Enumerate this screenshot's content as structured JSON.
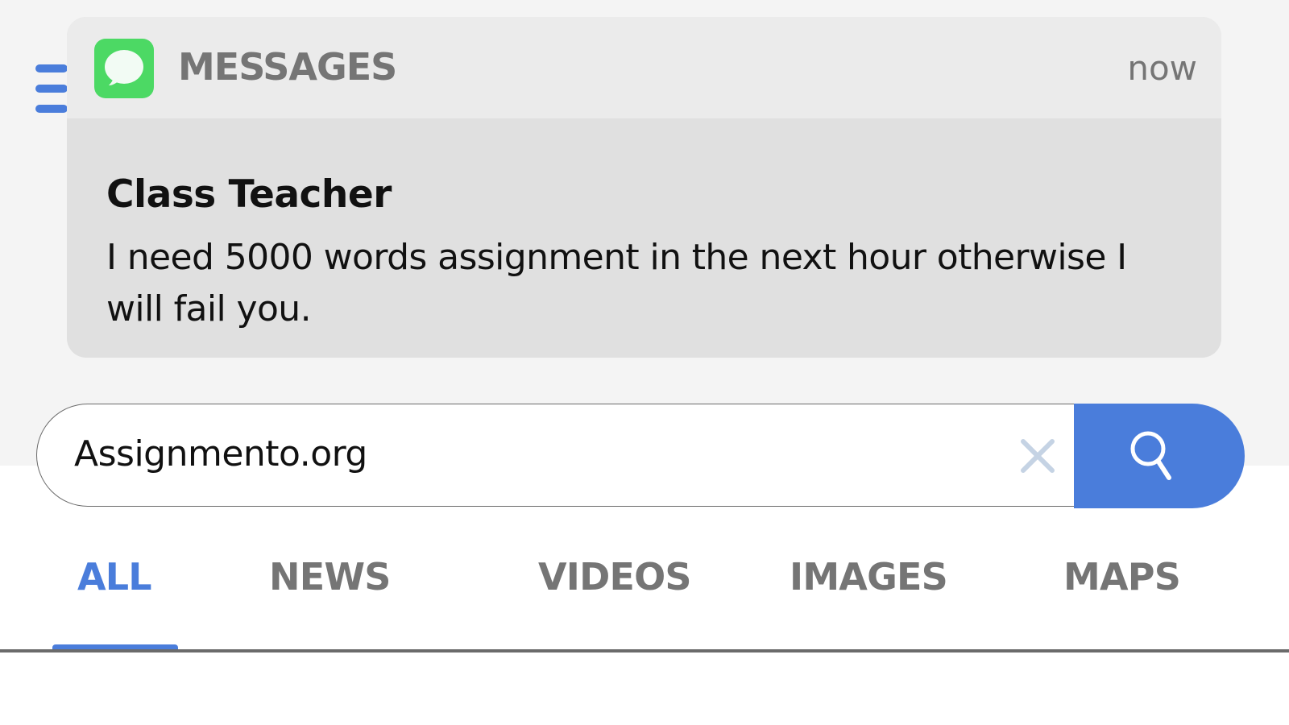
{
  "notification": {
    "app_name": "MESSAGES",
    "time": "now",
    "sender": "Class Teacher",
    "message": "I need 5000 words assignment in the next hour otherwise I will fail you.",
    "app_icon": "speech-bubble-icon",
    "app_icon_color": "#4cd964"
  },
  "search": {
    "query": "Assignmento.org",
    "clear_icon": "close-icon",
    "submit_icon": "search-icon",
    "accent_color": "#4a7ddb"
  },
  "tabs": [
    {
      "label": "ALL",
      "active": true
    },
    {
      "label": "NEWS",
      "active": false
    },
    {
      "label": "VIDEOS",
      "active": false
    },
    {
      "label": "IMAGES",
      "active": false
    },
    {
      "label": "MAPS",
      "active": false
    }
  ]
}
